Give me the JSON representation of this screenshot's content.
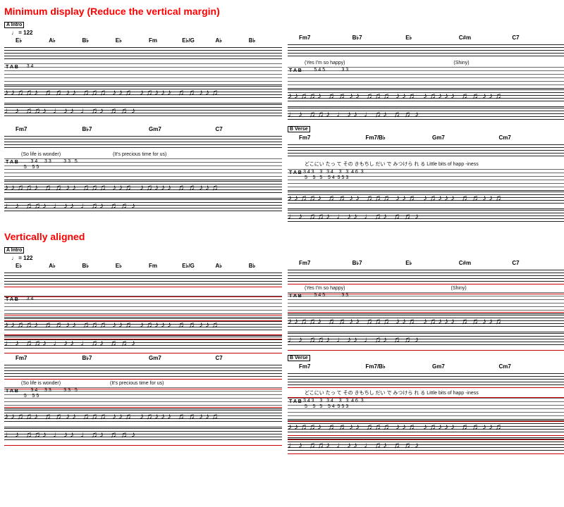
{
  "headings": {
    "minimum": "Minimum display (Reduce the vertical margin)",
    "aligned": "Vertically aligned"
  },
  "sections": {
    "intro": "Intro",
    "verse": "Verse"
  },
  "tempo": "♩ = 122",
  "tab_label": "T\nA\nB",
  "chords": {
    "row1_left": [
      "E♭",
      "A♭",
      "B♭",
      "E♭",
      "Fm",
      "E♭/G",
      "A♭",
      "B♭"
    ],
    "row1_right": [
      "Fm7",
      "B♭7",
      "E♭",
      "C#m",
      "C7"
    ],
    "row2_left": [
      "Fm7",
      "B♭7",
      "Gm7",
      "C7"
    ],
    "row2_right": [
      "Fm7",
      "Fm7/B♭",
      "Gm7",
      "Cm7"
    ]
  },
  "lyrics": {
    "happy": "(Yes I'm so happy)",
    "shiny": "(Shiny)",
    "wonder": "(So life is wonder)",
    "precious": "(It's precious time for us)",
    "jp": "どこにい たっ て その きもちし だい で みつけら れ る Little bits of happ -iness"
  },
  "tabs": {
    "r1l": "     3 4",
    "r1r": "        5 4 5            3 3",
    "r2l": "        3 4     3 3         3 3   5",
    "r2l_b": "   5    5 5",
    "r2r": "3 4 3    3   3 4    3   3  4 6  3",
    "r2r_b": " 5    5   5    5 4  5 5 3"
  },
  "notation": {
    "dense": "♪♪♫♫♪ ♬♬♪♪ ♫♫♫ ♪♪♬ ♪♫♪♪♪ ♬♬♪♪♫",
    "bass": "♩♪ ♫♫♪ ♩♪♪  ♩♫♪ ♬♬♪"
  }
}
